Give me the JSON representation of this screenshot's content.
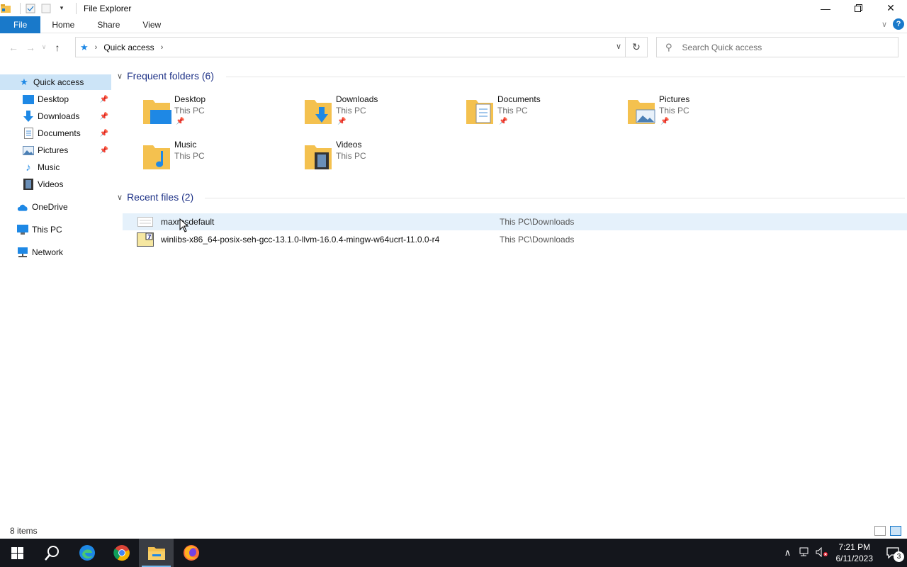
{
  "window": {
    "title": "File Explorer"
  },
  "ribbon": {
    "tabs": [
      "File",
      "Home",
      "Share",
      "View"
    ],
    "help_label": "?"
  },
  "navbar": {
    "breadcrumb": [
      "Quick access"
    ],
    "search_placeholder": "Search Quick access"
  },
  "sidebar": {
    "items": [
      {
        "label": "Quick access",
        "icon": "star-icon",
        "selected": true
      },
      {
        "label": "Desktop",
        "icon": "desktop-folder-icon",
        "pinned": true
      },
      {
        "label": "Downloads",
        "icon": "downloads-arrow-icon",
        "pinned": true
      },
      {
        "label": "Documents",
        "icon": "documents-icon",
        "pinned": true
      },
      {
        "label": "Pictures",
        "icon": "pictures-icon",
        "pinned": true
      },
      {
        "label": "Music",
        "icon": "music-note-icon"
      },
      {
        "label": "Videos",
        "icon": "video-film-icon"
      },
      {
        "label": "OneDrive",
        "icon": "cloud-icon"
      },
      {
        "label": "This PC",
        "icon": "computer-icon"
      },
      {
        "label": "Network",
        "icon": "network-icon"
      }
    ]
  },
  "frequent": {
    "header": "Frequent folders (6)",
    "folders": [
      {
        "name": "Desktop",
        "location": "This PC",
        "pinned": true
      },
      {
        "name": "Downloads",
        "location": "This PC",
        "pinned": true
      },
      {
        "name": "Documents",
        "location": "This PC",
        "pinned": true
      },
      {
        "name": "Pictures",
        "location": "This PC",
        "pinned": true
      },
      {
        "name": "Music",
        "location": "This PC",
        "pinned": false
      },
      {
        "name": "Videos",
        "location": "This PC",
        "pinned": false
      }
    ]
  },
  "recent": {
    "header": "Recent files (2)",
    "files": [
      {
        "name": "maxresdefault",
        "path": "This PC\\Downloads"
      },
      {
        "name": "winlibs-x86_64-posix-seh-gcc-13.1.0-llvm-16.0.4-mingw-w64ucrt-11.0.0-r4",
        "path": "This PC\\Downloads"
      }
    ]
  },
  "status": {
    "item_count": "8 items"
  },
  "taskbar": {
    "apps": [
      "start-icon",
      "search-icon",
      "edge-icon",
      "chrome-icon",
      "file-explorer-icon",
      "firefox-icon"
    ],
    "time": "7:21 PM",
    "date": "6/11/2023",
    "notification_count": "3"
  },
  "colors": {
    "accent": "#1979ca",
    "selection": "#cce4f7",
    "group_header": "#1e3287",
    "taskbar": "#14161c",
    "folder": "#f4c14f"
  }
}
